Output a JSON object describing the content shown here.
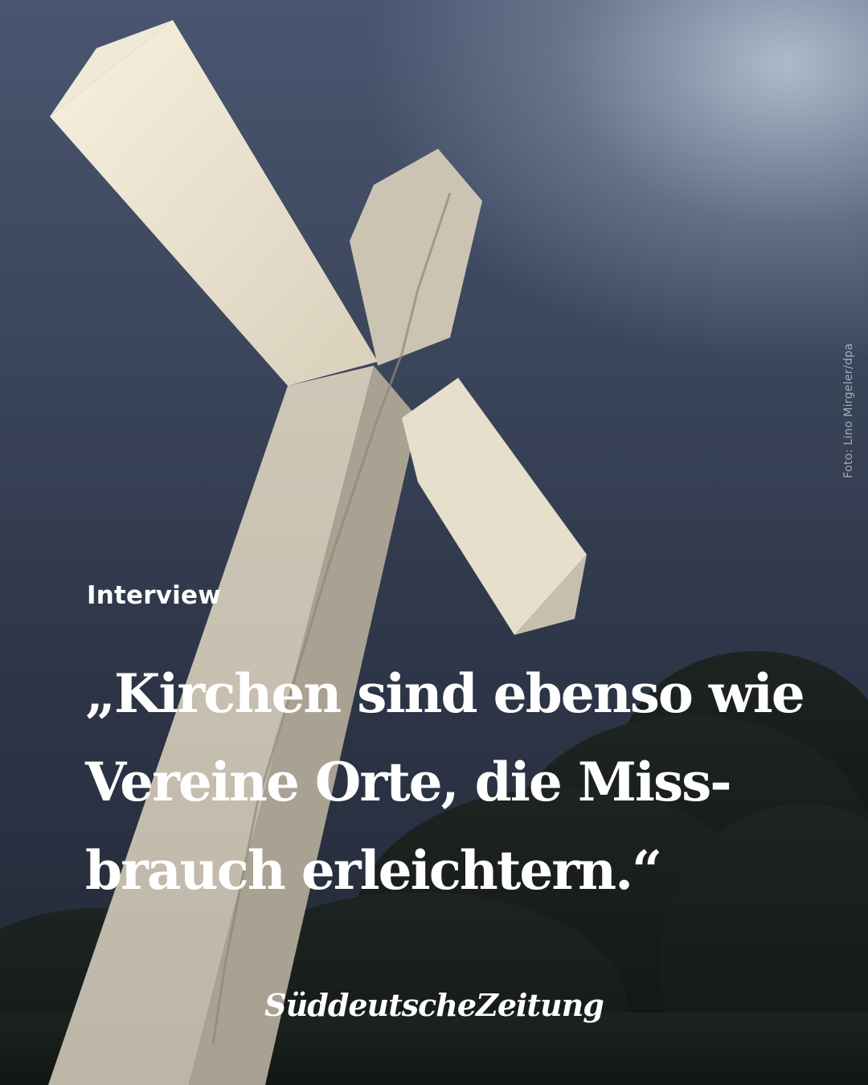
{
  "photo": {
    "credit": "Foto: Lino Mirgeler/dpa",
    "subject_icon": "cross-photo"
  },
  "post": {
    "kicker": "Interview",
    "quote_lines": [
      "„Kirchen sind ebenso wie",
      "Vereine Orte, die Miss-",
      "brauch erleichtern.“"
    ]
  },
  "brand": {
    "logo_text": "SüddeutscheZeitung"
  },
  "colors": {
    "text": "#ffffff",
    "sky": "#2b3345",
    "cross": "#e8e1cf"
  }
}
